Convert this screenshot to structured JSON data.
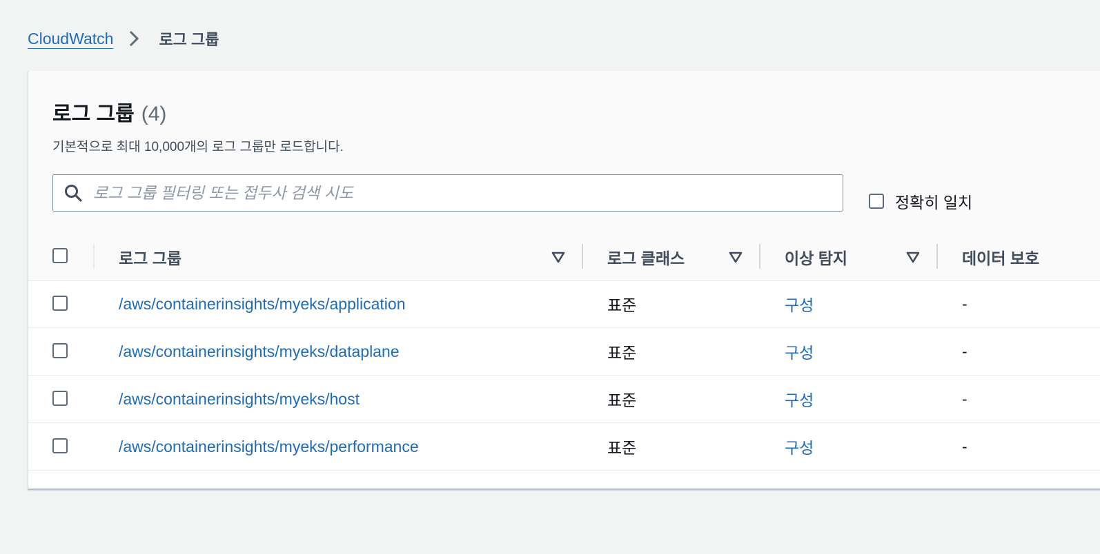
{
  "breadcrumb": {
    "root": "CloudWatch",
    "current": "로그 그룹"
  },
  "panel": {
    "title": "로그 그룹",
    "count": "(4)",
    "description": "기본적으로 최대 10,000개의 로그 그룹만 로드합니다."
  },
  "search": {
    "placeholder": "로그 그룹 필터링 또는 접두사 검색 시도",
    "value": ""
  },
  "exact_match": {
    "label": "정확히 일치",
    "checked": false
  },
  "columns": {
    "log_group": "로그 그룹",
    "log_class": "로그 클래스",
    "anomaly": "이상 탐지",
    "data_protection": "데이터 보호"
  },
  "rows": [
    {
      "name": "/aws/containerinsights/myeks/application",
      "log_class": "표준",
      "anomaly": "구성",
      "data_protection": "-"
    },
    {
      "name": "/aws/containerinsights/myeks/dataplane",
      "log_class": "표준",
      "anomaly": "구성",
      "data_protection": "-"
    },
    {
      "name": "/aws/containerinsights/myeks/host",
      "log_class": "표준",
      "anomaly": "구성",
      "data_protection": "-"
    },
    {
      "name": "/aws/containerinsights/myeks/performance",
      "log_class": "표준",
      "anomaly": "구성",
      "data_protection": "-"
    }
  ],
  "icons": {
    "breadcrumb_separator": "chevron-right-icon",
    "search": "search-icon",
    "sort": "sort-triangle-icon"
  },
  "colors": {
    "link": "#1f6bb8",
    "page_background": "#f2f3f3",
    "header_background": "#fafafa"
  }
}
